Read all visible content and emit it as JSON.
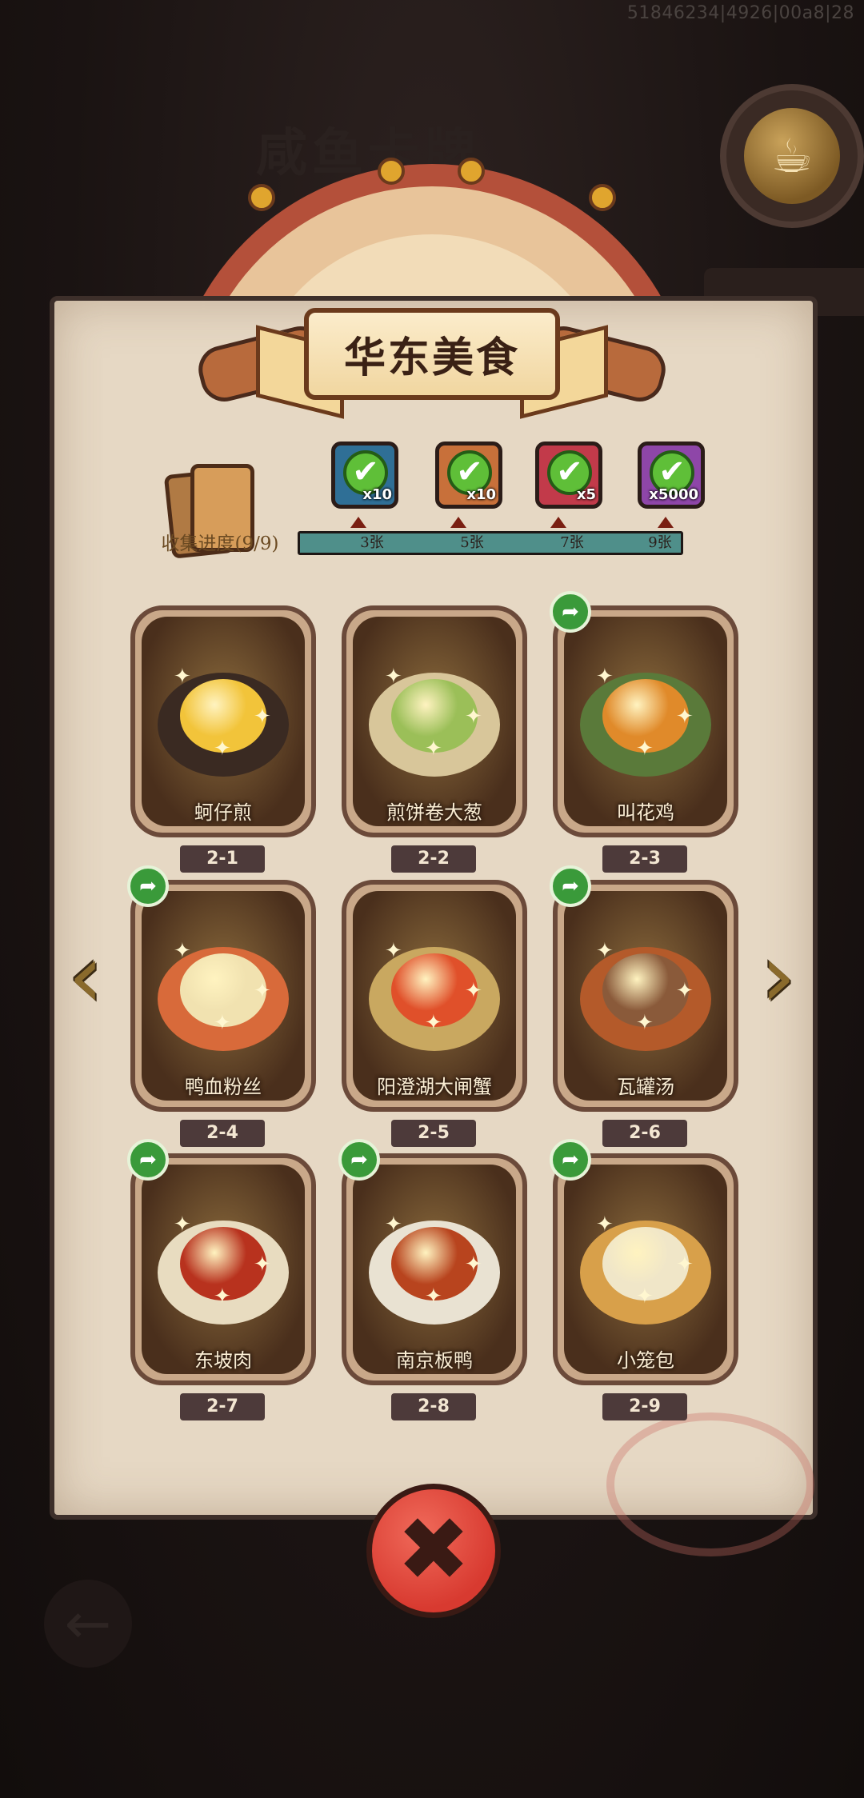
{
  "debug_id": "51846234|4926|00a8|28",
  "background": {
    "title_partial": "咸鱼卡牌",
    "back_icon": "left-arrow-icon",
    "cup_icon": "coffee-cup-icon"
  },
  "banner": {
    "title": "华东美食"
  },
  "collection": {
    "label": "收集进度(9/9)",
    "collected": 9,
    "total": 9,
    "milestones": [
      {
        "label": "3张",
        "reward_count": "x10",
        "reward_icon": "chest-reward-icon",
        "claimed": true
      },
      {
        "label": "5张",
        "reward_count": "x10",
        "reward_icon": "scroll-reward-icon",
        "claimed": true
      },
      {
        "label": "7张",
        "reward_count": "x5",
        "reward_icon": "orb-reward-icon",
        "claimed": true
      },
      {
        "label": "9张",
        "reward_count": "x5000",
        "reward_icon": "gem-reward-icon",
        "claimed": true
      }
    ]
  },
  "dishes": [
    {
      "name": "蚵仔煎",
      "tag": "2-1",
      "share": false,
      "plate": "#3a2a22",
      "food": "#f2c43a"
    },
    {
      "name": "煎饼卷大葱",
      "tag": "2-2",
      "share": false,
      "plate": "#d8c69a",
      "food": "#9bbf58"
    },
    {
      "name": "叫花鸡",
      "tag": "2-3",
      "share": true,
      "plate": "#5a7a3a",
      "food": "#e08a2a"
    },
    {
      "name": "鸭血粉丝",
      "tag": "2-4",
      "share": true,
      "plate": "#d86a3a",
      "food": "#f1e2b0"
    },
    {
      "name": "阳澄湖大闸蟹",
      "tag": "2-5",
      "share": false,
      "plate": "#c9a860",
      "food": "#e0502a"
    },
    {
      "name": "瓦罐汤",
      "tag": "2-6",
      "share": true,
      "plate": "#b45a2a",
      "food": "#8a5a3a"
    },
    {
      "name": "东坡肉",
      "tag": "2-7",
      "share": true,
      "plate": "#e8dcc0",
      "food": "#b8321e"
    },
    {
      "name": "南京板鸭",
      "tag": "2-8",
      "share": true,
      "plate": "#e9e2d2",
      "food": "#b8441e"
    },
    {
      "name": "小笼包",
      "tag": "2-9",
      "share": true,
      "plate": "#d8a04a",
      "food": "#f0e6c8"
    }
  ],
  "nav": {
    "prev_icon": "chevron-left-icon",
    "next_icon": "chevron-right-icon"
  },
  "close": {
    "icon": "close-icon",
    "glyph": "✖"
  },
  "share_glyph": "➦",
  "check_glyph": "✔"
}
